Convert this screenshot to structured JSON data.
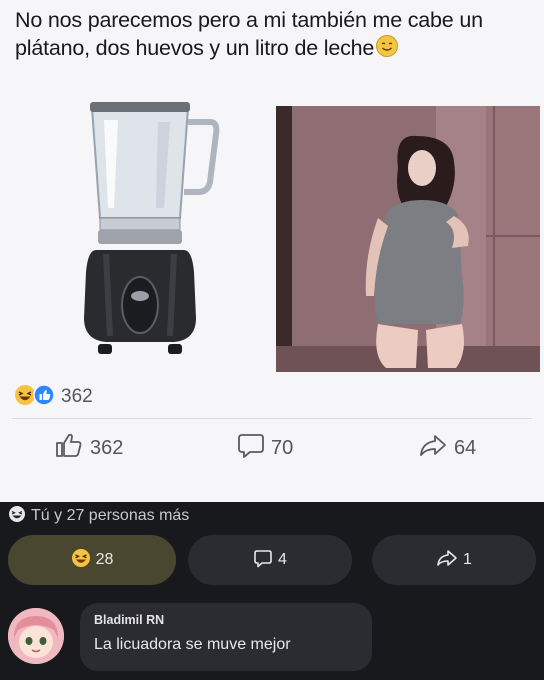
{
  "post": {
    "caption": "No nos parecemos pero a mi también me cabe un plátano, dos huevos y un litro de leche",
    "caption_emoji": "smiling-face-icon",
    "reaction_total": "362",
    "actions": {
      "like_count": "362",
      "comment_count": "70",
      "share_count": "64"
    }
  },
  "feed_bar": {
    "friends_text": "Tú y 27 personas más",
    "react_count": "28",
    "comment_count": "4",
    "share_count": "1",
    "react_pill_color": "#4a4731"
  },
  "comment": {
    "author": "Bladimil RN",
    "text": "La licuadora se muve mejor"
  }
}
